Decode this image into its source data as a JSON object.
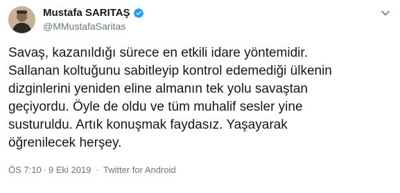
{
  "tweet": {
    "display_name": "Mustafa SARITAŞ",
    "handle": "@MMustafaSaritas",
    "verified": true,
    "text_lines": [
      "Savaş, kazanıldığı sürece en etkili idare yöntemidir.",
      "Sallanan koltuğunu sabitleyip kontrol edemediği ülkenin",
      "dizginlerini yeniden eline almanın tek yolu savaştan",
      "geçiyordu. Öyle de oldu ve tüm muhalif sesler yine",
      "susturuldu. Artık konuşmak faydasız. Yaşayarak",
      "öğrenilecek herşey."
    ],
    "time": "ÖS 7:10",
    "date": "9 Eki 2019",
    "separator": "·",
    "source": "Twitter for Android"
  },
  "icons": {
    "verified": "verified-badge-icon",
    "menu": "chevron-down-icon"
  },
  "colors": {
    "text": "#14171a",
    "secondary": "#657786",
    "verified_blue": "#1da1f2"
  }
}
